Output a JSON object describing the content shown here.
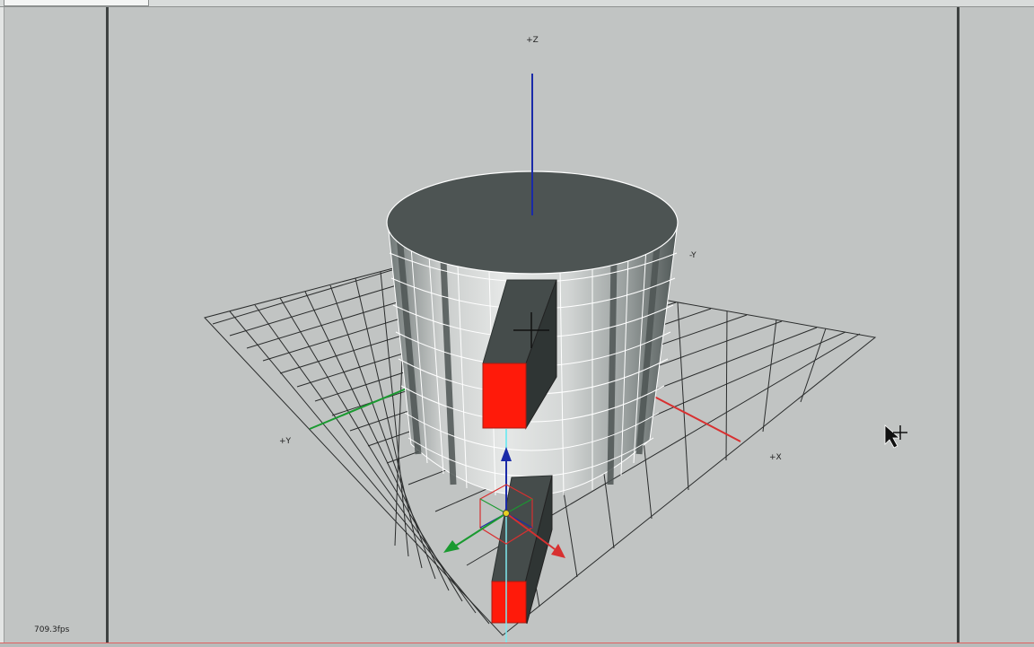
{
  "viewport": {
    "axis_labels": {
      "z": "+Z",
      "y_neg": "-Y",
      "y_pos": "+Y",
      "x_pos": "+X"
    }
  },
  "status": {
    "fps": "709.3fps"
  },
  "colors": {
    "background": "#c1c4c3",
    "cylinder_top": "#4d5453",
    "box_red": "#ff1a0a",
    "z_axis": "#1a2aa8",
    "x_axis": "#d83030",
    "y_axis": "#1a9a30"
  },
  "icons": {
    "cursor": "move-cursor-icon",
    "gizmo": "transform-gizmo"
  }
}
